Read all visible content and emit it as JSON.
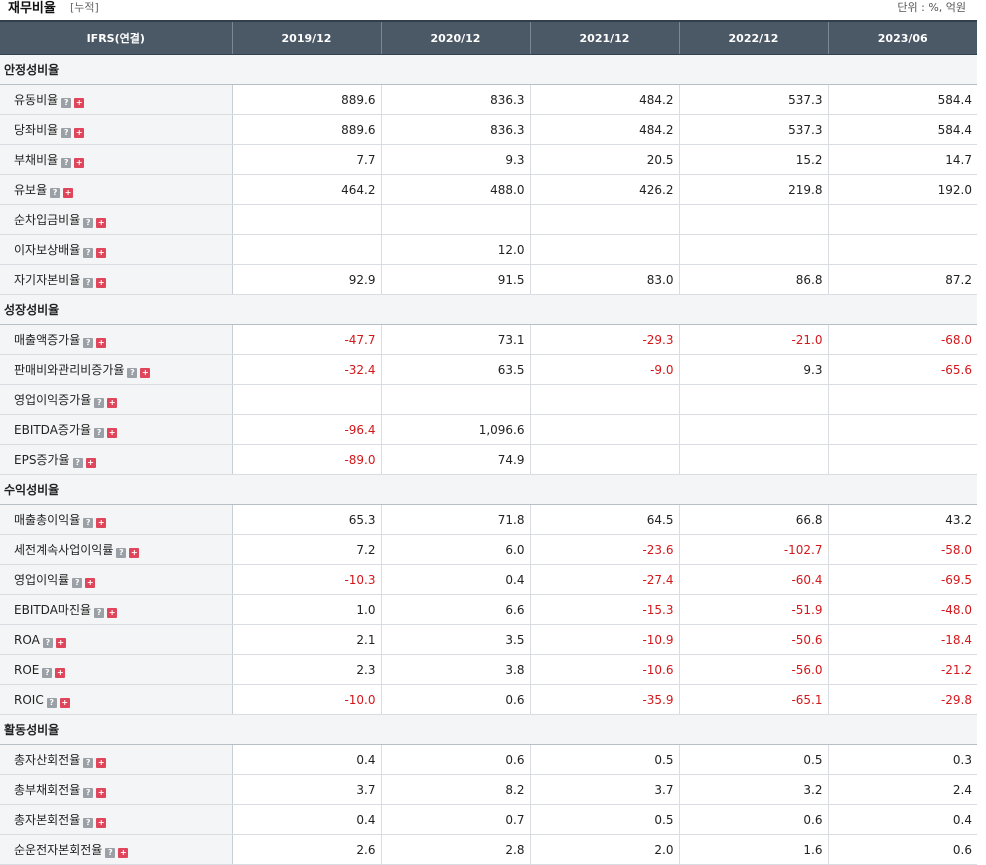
{
  "header": {
    "title": "재무비율",
    "cumulative": "[누적]",
    "unit": "단위 : %, 억원"
  },
  "table": {
    "corner": "IFRS(연결)",
    "periods": [
      "2019/12",
      "2020/12",
      "2021/12",
      "2022/12",
      "2023/06"
    ],
    "sections": [
      {
        "title": "안정성비율",
        "rows": [
          {
            "label": "유동비율",
            "values": [
              "889.6",
              "836.3",
              "484.2",
              "537.3",
              "584.4"
            ]
          },
          {
            "label": "당좌비율",
            "values": [
              "889.6",
              "836.3",
              "484.2",
              "537.3",
              "584.4"
            ]
          },
          {
            "label": "부채비율",
            "values": [
              "7.7",
              "9.3",
              "20.5",
              "15.2",
              "14.7"
            ]
          },
          {
            "label": "유보율",
            "values": [
              "464.2",
              "488.0",
              "426.2",
              "219.8",
              "192.0"
            ]
          },
          {
            "label": "순차입금비율",
            "values": [
              "",
              "",
              "",
              "",
              ""
            ]
          },
          {
            "label": "이자보상배율",
            "values": [
              "",
              "12.0",
              "",
              "",
              ""
            ]
          },
          {
            "label": "자기자본비율",
            "values": [
              "92.9",
              "91.5",
              "83.0",
              "86.8",
              "87.2"
            ]
          }
        ]
      },
      {
        "title": "성장성비율",
        "rows": [
          {
            "label": "매출액증가율",
            "values": [
              "-47.7",
              "73.1",
              "-29.3",
              "-21.0",
              "-68.0"
            ]
          },
          {
            "label": "판매비와관리비증가율",
            "values": [
              "-32.4",
              "63.5",
              "-9.0",
              "9.3",
              "-65.6"
            ]
          },
          {
            "label": "영업이익증가율",
            "values": [
              "",
              "",
              "",
              "",
              ""
            ]
          },
          {
            "label": "EBITDA증가율",
            "values": [
              "-96.4",
              "1,096.6",
              "",
              "",
              ""
            ]
          },
          {
            "label": "EPS증가율",
            "values": [
              "-89.0",
              "74.9",
              "",
              "",
              ""
            ]
          }
        ]
      },
      {
        "title": "수익성비율",
        "rows": [
          {
            "label": "매출총이익율",
            "values": [
              "65.3",
              "71.8",
              "64.5",
              "66.8",
              "43.2"
            ]
          },
          {
            "label": "세전계속사업이익률",
            "values": [
              "7.2",
              "6.0",
              "-23.6",
              "-102.7",
              "-58.0"
            ]
          },
          {
            "label": "영업이익률",
            "values": [
              "-10.3",
              "0.4",
              "-27.4",
              "-60.4",
              "-69.5"
            ]
          },
          {
            "label": "EBITDA마진율",
            "values": [
              "1.0",
              "6.6",
              "-15.3",
              "-51.9",
              "-48.0"
            ]
          },
          {
            "label": "ROA",
            "values": [
              "2.1",
              "3.5",
              "-10.9",
              "-50.6",
              "-18.4"
            ]
          },
          {
            "label": "ROE",
            "values": [
              "2.3",
              "3.8",
              "-10.6",
              "-56.0",
              "-21.2"
            ]
          },
          {
            "label": "ROIC",
            "values": [
              "-10.0",
              "0.6",
              "-35.9",
              "-65.1",
              "-29.8"
            ]
          }
        ]
      },
      {
        "title": "활동성비율",
        "rows": [
          {
            "label": "총자산회전율",
            "values": [
              "0.4",
              "0.6",
              "0.5",
              "0.5",
              "0.3"
            ]
          },
          {
            "label": "총부채회전율",
            "values": [
              "3.7",
              "8.2",
              "3.7",
              "3.2",
              "2.4"
            ]
          },
          {
            "label": "총자본회전율",
            "values": [
              "0.4",
              "0.7",
              "0.5",
              "0.6",
              "0.4"
            ]
          },
          {
            "label": "순운전자본회전율",
            "values": [
              "2.6",
              "2.8",
              "2.0",
              "1.6",
              "0.6"
            ]
          }
        ]
      }
    ]
  },
  "icons": {
    "help": "?",
    "expand": "+"
  },
  "colors": {
    "header_bg": "#4b5866",
    "negative": "#d4171b",
    "expand_icon": "#e0465b",
    "help_icon": "#9aa0a6"
  }
}
